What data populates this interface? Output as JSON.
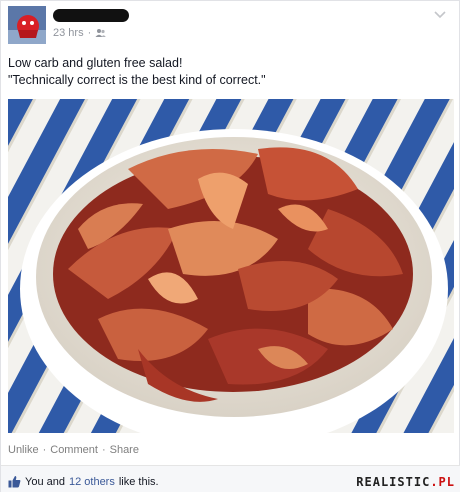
{
  "post": {
    "time": "23 hrs",
    "separator": "·",
    "audience_icon": "friends-icon",
    "menu_icon": "chevron-down-icon",
    "text_line1": "Low carb and gluten free salad!",
    "text_line2": "\"Technically correct is the best kind of correct.\"",
    "photo_alt": "bowl of bacon"
  },
  "actions": {
    "unlike": "Unlike",
    "comment": "Comment",
    "share": "Share",
    "dot": "·"
  },
  "likes": {
    "icon": "thumbs-up-icon",
    "you": "You and",
    "others": "12 others",
    "suffix": "like this."
  },
  "watermark": {
    "main": "REALISTIC",
    "suffix": ".PL"
  },
  "colors": {
    "link": "#3b5998",
    "muted": "#90949c",
    "bacon": "#b8432f",
    "bowl": "#ffffff",
    "tablecloth_stripe": "#2e56a8"
  }
}
